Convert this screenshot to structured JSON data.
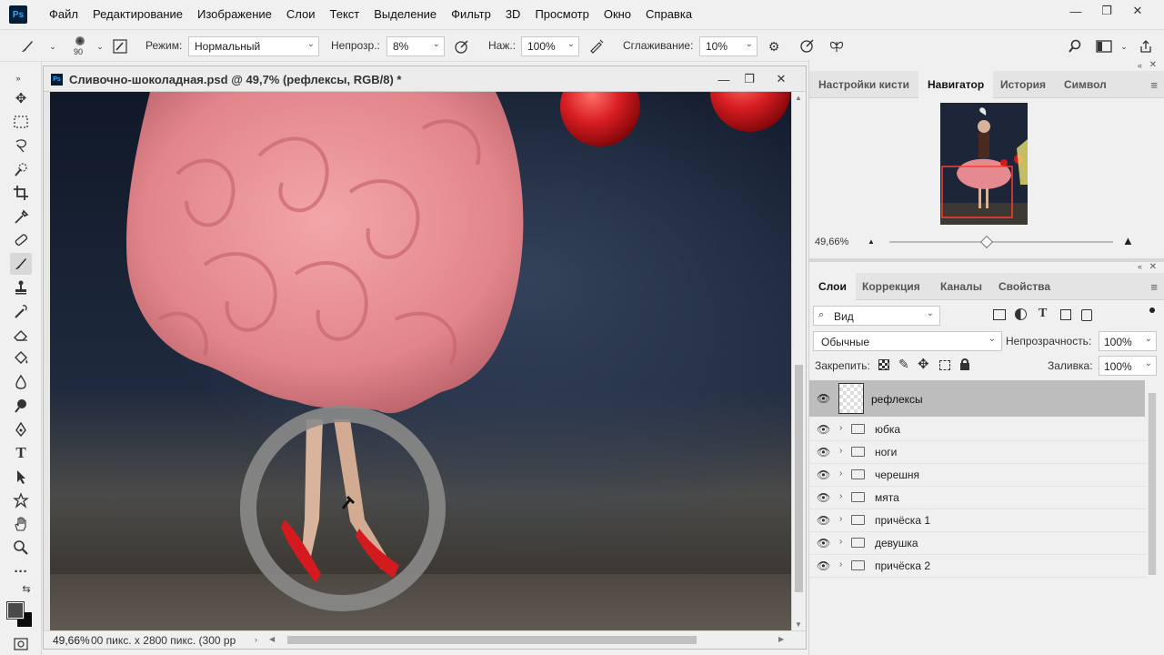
{
  "app": {
    "logo": "Ps",
    "menu": [
      "Файл",
      "Редактирование",
      "Изображение",
      "Слои",
      "Текст",
      "Выделение",
      "Фильтр",
      "3D",
      "Просмотр",
      "Окно",
      "Справка"
    ],
    "window_controls": [
      "—",
      "❐",
      "✕"
    ]
  },
  "options": {
    "brush_size": "90",
    "mode_label": "Режим:",
    "mode_value": "Нормальный",
    "opacity_label": "Непрозр.:",
    "opacity_value": "8%",
    "flow_label": "Наж.:",
    "flow_value": "100%",
    "smoothing_label": "Сглаживание:",
    "smoothing_value": "10%"
  },
  "document": {
    "title": "Сливочно-шоколадная.psd @ 49,7% (рефлексы, RGB/8) *",
    "icon": "Ps",
    "zoom": "49,66%",
    "size_info": "00 пикс. x 2800 пикс. (300 рр",
    "controls": [
      "—",
      "❐",
      "✕"
    ]
  },
  "panels": {
    "top_tabs": [
      "Настройки кисти",
      "Навигатор",
      "История",
      "Символ"
    ],
    "top_active": "Навигатор",
    "navigator_zoom": "49,66%",
    "layers_tabs": [
      "Слои",
      "Коррекция",
      "Каналы",
      "Свойства"
    ],
    "layers_active": "Слои",
    "filter_label": "Вид",
    "blend_mode": "Обычные",
    "opacity_label": "Непрозрачность:",
    "opacity_value": "100%",
    "lock_label": "Закрепить:",
    "fill_label": "Заливка:",
    "fill_value": "100%"
  },
  "layers": [
    {
      "name": "рефлексы",
      "type": "layer",
      "selected": true
    },
    {
      "name": "юбка",
      "type": "group"
    },
    {
      "name": "ноги",
      "type": "group"
    },
    {
      "name": "черешня",
      "type": "group"
    },
    {
      "name": "мята",
      "type": "group"
    },
    {
      "name": "причёска 1",
      "type": "group"
    },
    {
      "name": "девушка",
      "type": "group"
    },
    {
      "name": "причёска 2",
      "type": "group"
    }
  ],
  "colors": {
    "accent_selected_layer": "#bdbdbd",
    "canvas_background": "#1a2233",
    "skirt_pink": "#e7868c",
    "shoe_red": "#d21a1f"
  }
}
